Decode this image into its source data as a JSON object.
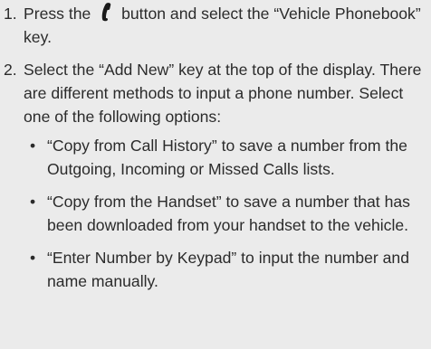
{
  "steps": [
    {
      "number": "1.",
      "text_before_icon": "Press the",
      "icon": "phone-handset-icon",
      "text_after_icon": "button and select the “Vehicle Phonebook” key."
    },
    {
      "number": "2.",
      "text": "Select the “Add New” key at the top of the display. There are different methods to input a phone number. Select one of the following options:",
      "bullets": [
        {
          "marker": "•",
          "text": "“Copy from Call History” to save a number from the Outgoing, Incoming or Missed Calls lists."
        },
        {
          "marker": "•",
          "text": "“Copy from the Handset” to save a number that has been downloaded from your handset to the vehicle."
        },
        {
          "marker": "•",
          "text": "“Enter Number by Keypad” to input the number and name manually."
        }
      ]
    }
  ]
}
